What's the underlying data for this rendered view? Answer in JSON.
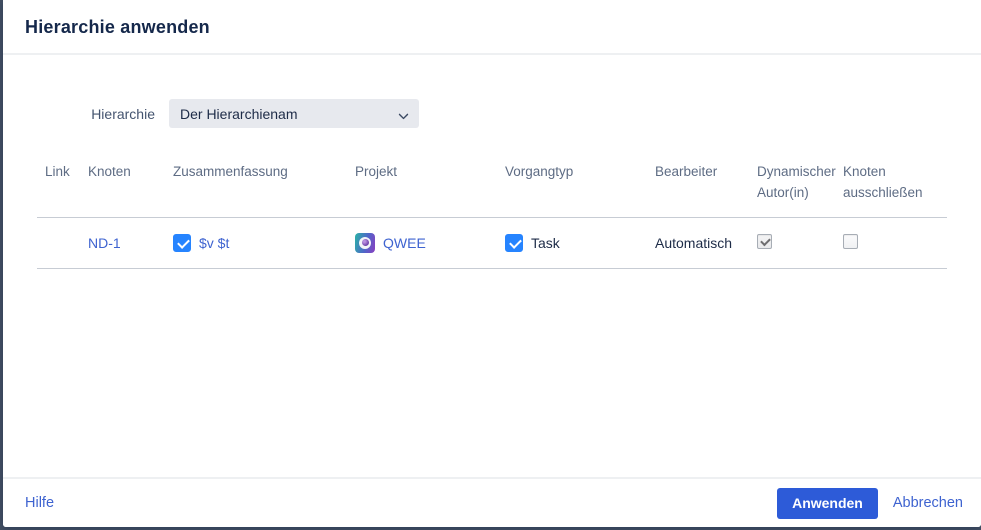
{
  "dialog": {
    "title": "Hierarchie anwenden"
  },
  "form": {
    "hierarchy_label": "Hierarchie",
    "hierarchy_selected_value": "Der Hierarchienam"
  },
  "table": {
    "headers": {
      "link": "Link",
      "knoten": "Knoten",
      "zusammenfassung": "Zusammenfassung",
      "projekt": "Projekt",
      "vorgangtyp": "Vorgangtyp",
      "bearbeiter": "Bearbeiter",
      "dynamischer_autor": "Dynamischer Autor(in)",
      "knoten_ausschliessen": "Knoten ausschließen"
    },
    "rows": [
      {
        "link": "",
        "knoten": "ND-1",
        "zusammenfassung": "$v $t",
        "zusammenfassung_checked": true,
        "projekt": "QWEE",
        "vorgangtyp": "Task",
        "vorgangtyp_checked": true,
        "bearbeiter": "Automatisch",
        "dynamischer_autor_checked": true,
        "dynamischer_autor_disabled": true,
        "knoten_ausschliessen_checked": false
      }
    ]
  },
  "footer": {
    "help_label": "Hilfe",
    "apply_label": "Anwenden",
    "cancel_label": "Abbrechen"
  },
  "icons": {
    "select_chevron": "chevron-down",
    "project_avatar": "project-avatar-gradient-sphere"
  },
  "colors": {
    "primary_button": "#2d5bd8",
    "checkbox_blue": "#2684ff",
    "link": "#3e63d0",
    "title_text": "#15284b",
    "header_text": "#5e6c84",
    "backdrop": "#445063"
  }
}
